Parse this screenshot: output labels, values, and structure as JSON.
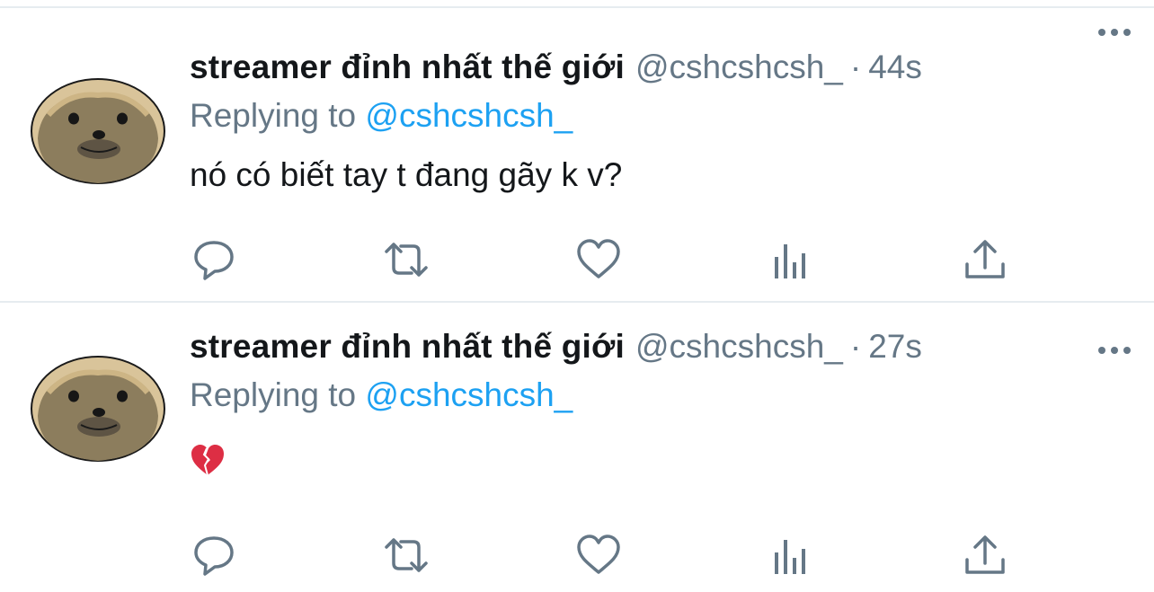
{
  "tweets": [
    {
      "display_name": "streamer đỉnh nhất thế giới",
      "handle": "@cshcshcsh_",
      "separator": "·",
      "time": "44s",
      "replying_prefix": "Replying to",
      "replying_handle": "@cshcshcsh_",
      "text": "nó có biết tay t đang gãy k v?",
      "actions": [
        "reply-icon",
        "retweet-icon",
        "like-icon",
        "analytics-icon",
        "share-icon"
      ]
    },
    {
      "display_name": "streamer đỉnh nhất thế giới",
      "handle": "@cshcshcsh_",
      "separator": "·",
      "time": "27s",
      "replying_prefix": "Replying to",
      "replying_handle": "@cshcshcsh_",
      "text": "",
      "emoji": "broken-heart-emoji",
      "actions": [
        "reply-icon",
        "retweet-icon",
        "like-icon",
        "analytics-icon",
        "share-icon"
      ]
    }
  ],
  "colors": {
    "text": "#14171a",
    "secondary": "#657786",
    "link": "#1da1f2",
    "divider": "#e6ecf0",
    "avatar_fur": "#8c7d5d",
    "avatar_face": "#d9c49a"
  }
}
